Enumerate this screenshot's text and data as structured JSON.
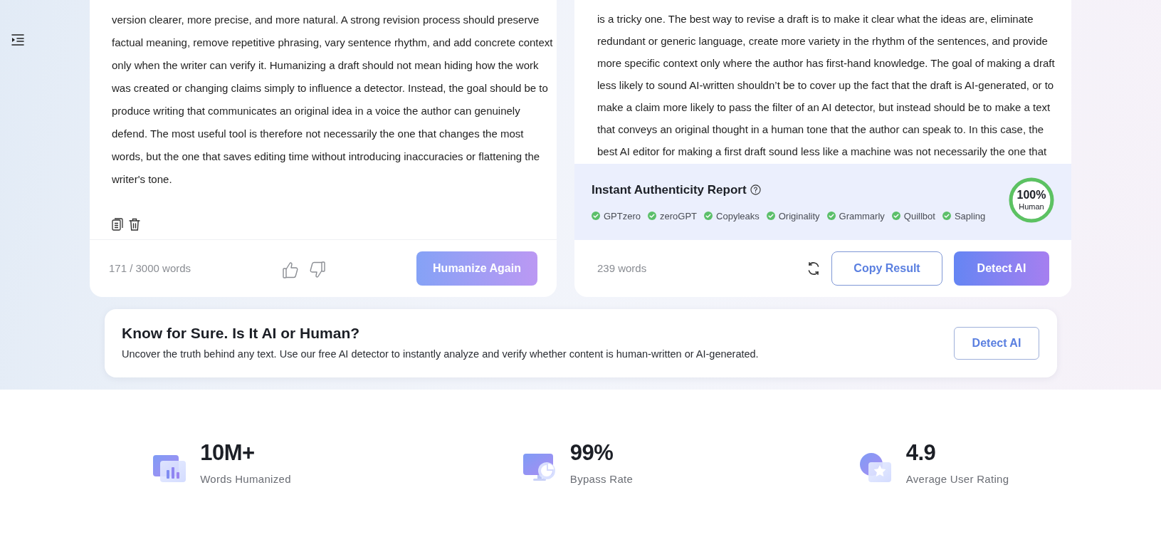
{
  "input_panel": {
    "paragraph_lines": [
      "version clearer, more precise, and more natural. A strong revision process should preserve",
      "factual meaning, remove repetitive phrasing, vary sentence rhythm, and add concrete context",
      "only when the writer can verify it. Humanizing a draft should not mean hiding how the work",
      "was created or changing claims simply to influence a detector. Instead, the goal should be to",
      "produce writing that communicates an original idea in a voice the author can genuinely",
      "defend. The most useful tool is therefore not necessarily the one that changes the most",
      "words, but the one that saves editing time without introducing inaccuracies or flattening the",
      "writer's tone."
    ],
    "word_count": "171 / 3000 words",
    "button": "Humanize Again"
  },
  "output_panel": {
    "paragraph_lines": [
      "is a tricky one. The best way to revise a draft is to make it clear what the ideas are, eliminate",
      "redundant or generic language, create more variety in the rhythm of the sentences, and provide",
      "more specific context only where the author has first-hand knowledge. The goal of making a draft",
      "less likely to sound AI-written shouldn’t be to cover up the fact that the draft is AI-generated, or to",
      "make a claim more likely to pass the filter of an AI detector, but instead should be to make a text",
      "that conveys an original thought in a human tone that the author can speak to. In this case, the",
      "best AI editor for making a first draft sound less like a machine was not necessarily the one that"
    ],
    "report": {
      "title": "Instant Authenticity Report",
      "detectors": [
        {
          "name": "GPTzero",
          "passed": true
        },
        {
          "name": "zeroGPT",
          "passed": true
        },
        {
          "name": "Copyleaks",
          "passed": true
        },
        {
          "name": "Originality",
          "passed": true
        },
        {
          "name": "Grammarly",
          "passed": true
        },
        {
          "name": "Quillbot",
          "passed": true
        },
        {
          "name": "Sapling",
          "passed": true
        }
      ],
      "score": {
        "value": "100%",
        "label": "Human",
        "level": 1
      }
    },
    "word_count": "239 words",
    "buttons": [
      {
        "label": "Copy Result",
        "kind": "outline"
      },
      {
        "label": "Detect AI",
        "kind": "filled"
      }
    ]
  },
  "banner": {
    "title": "Know for Sure. Is It AI or Human?",
    "text": "Uncover the truth behind any text. Use our free AI detector to instantly analyze and verify whether content is human-written or AI-generated.",
    "button": "Detect AI"
  },
  "stats": [
    {
      "kind": "bars",
      "value": "10M+",
      "label": "Words Humanized"
    },
    {
      "kind": "pie",
      "value": "99%",
      "label": "Bypass Rate"
    },
    {
      "kind": "star",
      "value": "4.9",
      "label": "Average User Rating"
    }
  ]
}
